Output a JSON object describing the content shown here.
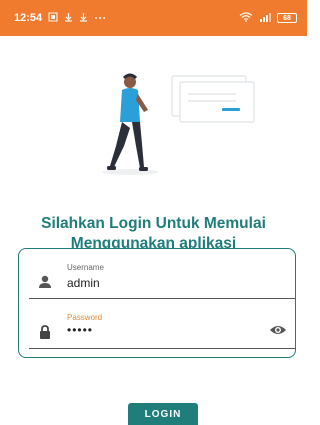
{
  "status_bar": {
    "time": "12:54",
    "battery": "68",
    "left_icons": [
      "sim-icon",
      "download-icon",
      "download-icon",
      "more-icon"
    ],
    "right_icons": [
      "wifi-icon",
      "signal-icon",
      "battery-icon"
    ]
  },
  "illustration": {
    "name": "person-with-card-illustration"
  },
  "header": {
    "line1": "Silahkan Login Untuk Memulai",
    "line2": "Menggunakan aplikasi"
  },
  "form": {
    "username_label": "Username",
    "username_value": "admin",
    "password_label": "Password",
    "password_value": "•••••"
  },
  "login_button": {
    "label": "LOGIN"
  },
  "colors": {
    "status_bar": "#f07b2f",
    "primary": "#1f7d7a",
    "password_label": "#e88a3a",
    "illustration_accent": "#2a9fd8"
  }
}
